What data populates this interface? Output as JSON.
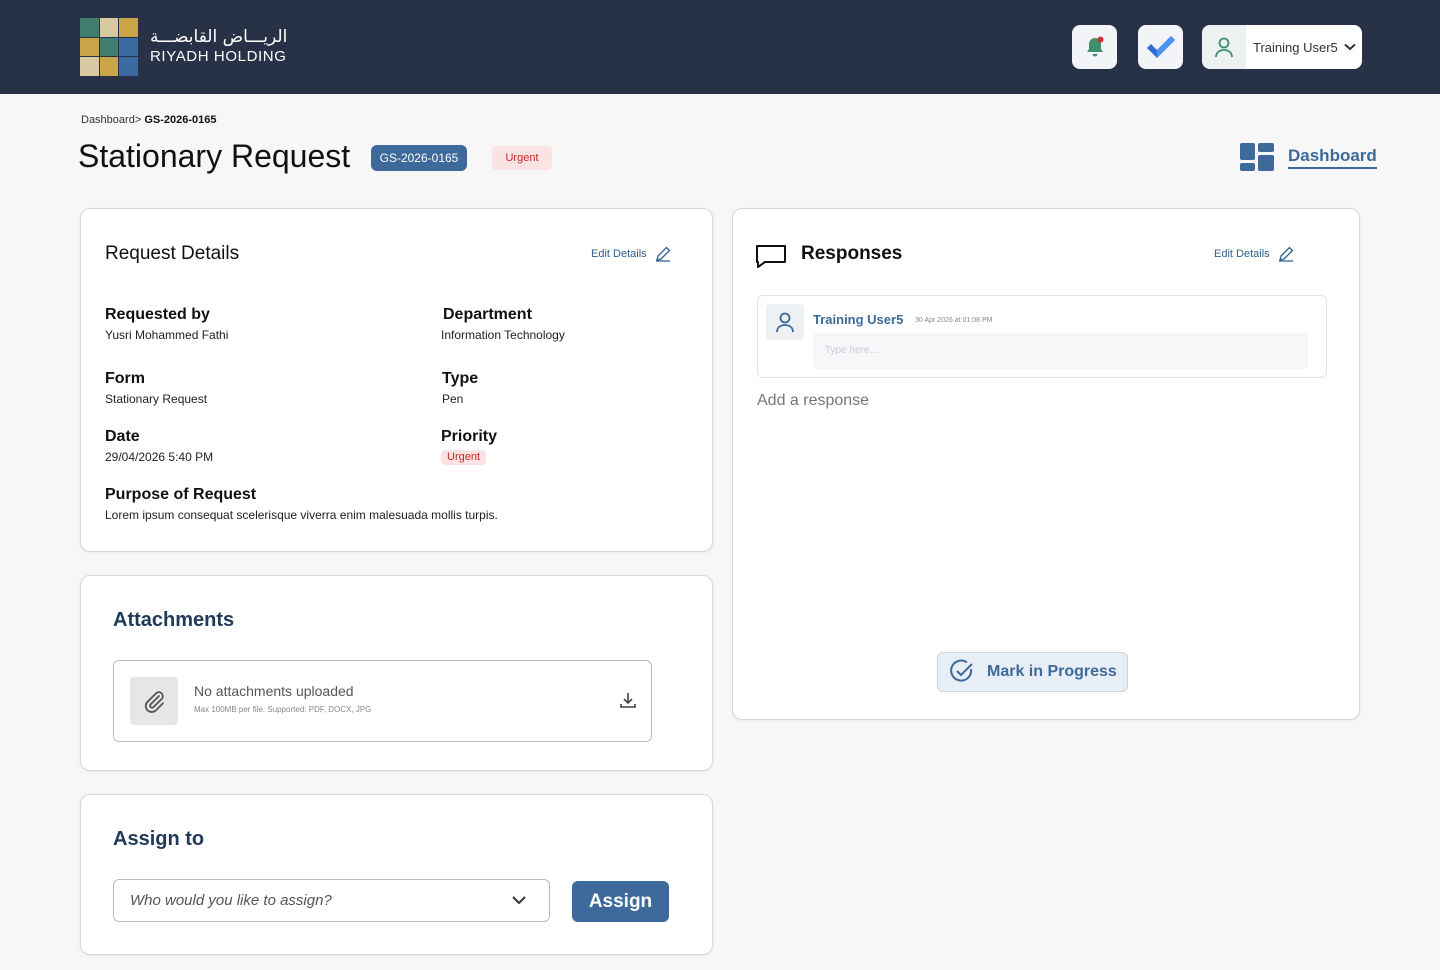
{
  "header": {
    "logo_arabic": "الريـــاض القابضـــة",
    "logo_english": "RIYADH HOLDING",
    "user_name": "Training User5"
  },
  "breadcrumb": {
    "parent": "Dashboard>",
    "current": "GS-2026-0165"
  },
  "page": {
    "title": "Stationary Request",
    "id_badge": "GS-2026-0165",
    "urgency_badge": "Urgent",
    "dashboard_link": "Dashboard"
  },
  "request_details": {
    "title": "Request Details",
    "edit_label": "Edit Details",
    "fields": [
      {
        "label": "Requested by",
        "value": "Yusri Mohammed Fathi"
      },
      {
        "label": "Department",
        "value": "Information Technology"
      },
      {
        "label": "Form",
        "value": "Stationary Request"
      },
      {
        "label": "Type",
        "value": "Pen"
      },
      {
        "label": "Date",
        "value": "29/04/2026 5:40 PM"
      },
      {
        "label": "Priority",
        "value": "Urgent"
      },
      {
        "label": "Purpose of Request",
        "value": "Lorem ipsum consequat scelerisque viverra enim malesuada mollis turpis."
      }
    ]
  },
  "attachments": {
    "title": "Attachments",
    "empty_text": "No attachments uploaded",
    "hint": "Max 100MB per file. Supported: PDF, DOCX, JPG"
  },
  "assign": {
    "title": "Assign to",
    "placeholder": "Who would you like to assign?",
    "button_label": "Assign"
  },
  "responses": {
    "title": "Responses",
    "edit_label": "Edit Details",
    "entries": [
      {
        "user": "Training User5",
        "timestamp": "30 Apr 2026 at 01:08 PM",
        "input_placeholder": "Type here..."
      }
    ],
    "add_label": "Add a response",
    "mark_label": "Mark in Progress"
  },
  "colors": {
    "topbar": "#283246",
    "accent": "#3d6a9a",
    "urgent_bg": "#fbe3e3",
    "urgent_text": "#c62828",
    "heading_dark": "#1f3a58"
  },
  "icons": [
    "bell-icon",
    "checkmark-icon",
    "user-icon",
    "chevron-down-icon",
    "dashboard-grid-icon",
    "pencil-icon",
    "chat-bubble-icon",
    "paperclip-icon",
    "download-icon",
    "check-circle-icon"
  ]
}
